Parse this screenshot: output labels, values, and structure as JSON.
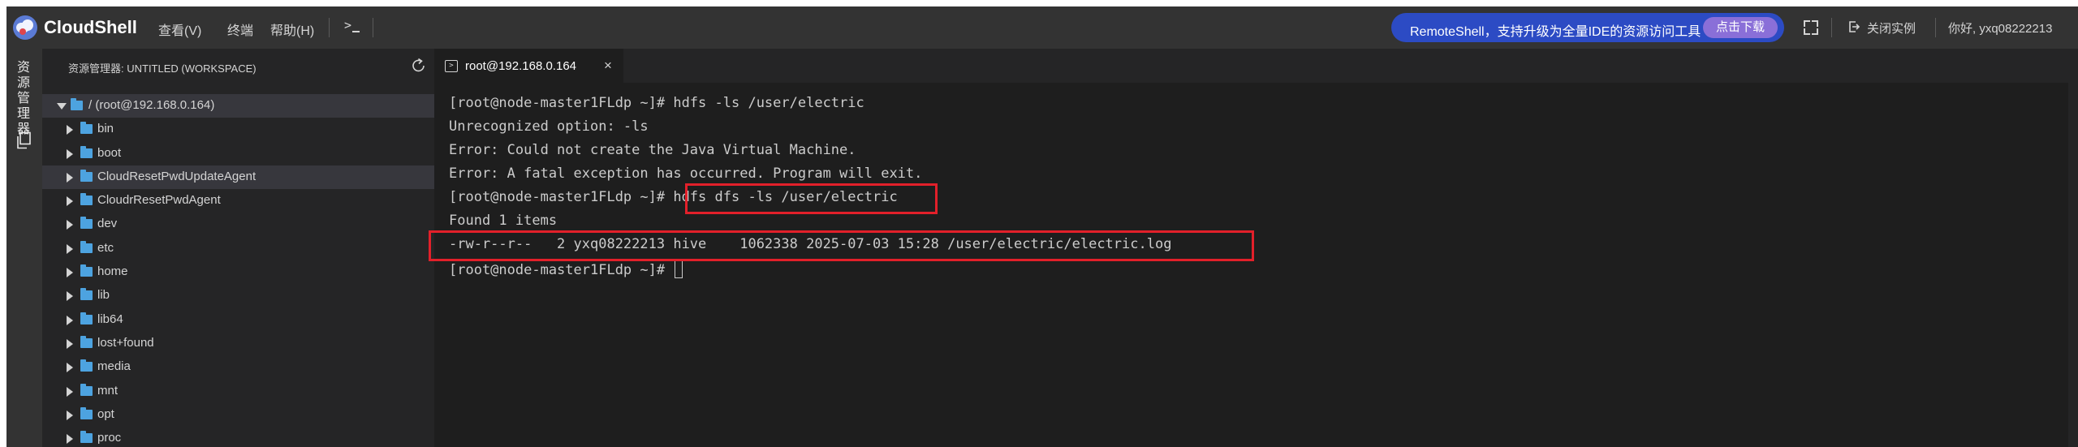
{
  "topbar": {
    "brand": "CloudShell",
    "menus": [
      "查看(V)",
      "终端",
      "帮助(H)"
    ],
    "banner_text": "RemoteShell，支持升级为全量IDE的资源访问工具",
    "banner_button": "点击下载",
    "close_instance": "关闭实例",
    "greeting": "你好, yxq08222213",
    "accent_color": "#2c4bc4"
  },
  "activity": {
    "explorer_label": "资源管理器"
  },
  "sidebar": {
    "title": "资源管理器: UNTITLED (WORKSPACE)",
    "root": "/ (root@192.168.0.164)",
    "items": [
      "bin",
      "boot",
      "CloudResetPwdUpdateAgent",
      "CloudrResetPwdAgent",
      "dev",
      "etc",
      "home",
      "lib",
      "lib64",
      "lost+found",
      "media",
      "mnt",
      "opt",
      "proc"
    ],
    "selected": "CloudResetPwdUpdateAgent"
  },
  "tab": {
    "label": "root@192.168.0.164",
    "close": "×"
  },
  "terminal": {
    "lines": [
      "[root@node-master1FLdp ~]# hdfs -ls /user/electric",
      "Unrecognized option: -ls",
      "Error: Could not create the Java Virtual Machine.",
      "Error: A fatal exception has occurred. Program will exit.",
      "[root@node-master1FLdp ~]# hdfs dfs -ls /user/electric",
      "Found 1 items",
      "-rw-r--r--   2 yxq08222213 hive    1062338 2025-07-03 15:28 /user/electric/electric.log",
      "[root@node-master1FLdp ~]# "
    ],
    "highlight_color": "#e2202a"
  }
}
